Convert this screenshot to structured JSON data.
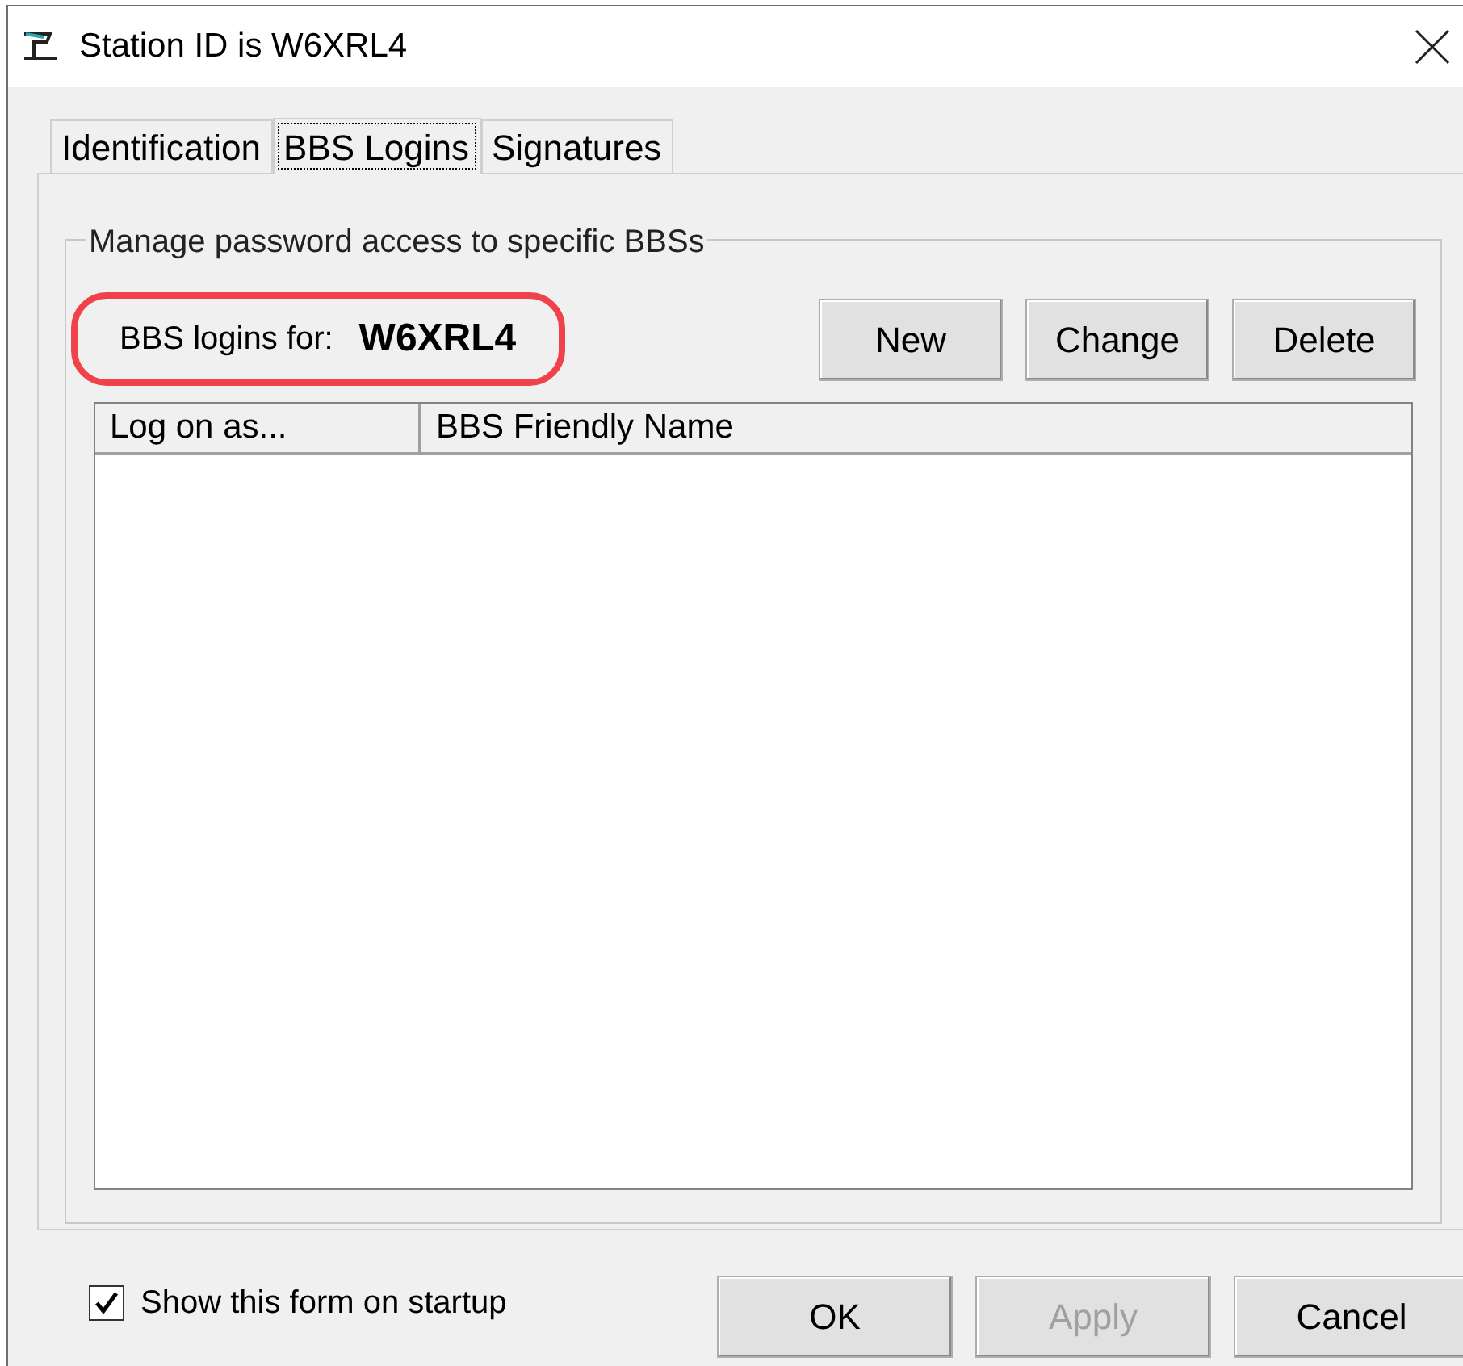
{
  "window": {
    "title": "Station ID is W6XRL4"
  },
  "tabs": [
    {
      "label": "Identification",
      "selected": false
    },
    {
      "label": "BBS Logins",
      "selected": true
    },
    {
      "label": "Signatures",
      "selected": false
    }
  ],
  "group": {
    "title": "Manage password access to specific BBSs",
    "logins_label": "BBS logins for:",
    "station": "W6XRL4",
    "highlighted": true,
    "buttons": [
      {
        "label": "New"
      },
      {
        "label": "Change"
      },
      {
        "label": "Delete"
      }
    ],
    "table": {
      "columns": [
        "Log on as...",
        "BBS Friendly Name"
      ]
    }
  },
  "startup_checkbox": {
    "label": "Show this form on startup",
    "checked": true
  },
  "buttons": [
    {
      "label": "OK",
      "disabled": false
    },
    {
      "label": "Apply",
      "disabled": true
    },
    {
      "label": "Cancel",
      "disabled": false
    }
  ]
}
